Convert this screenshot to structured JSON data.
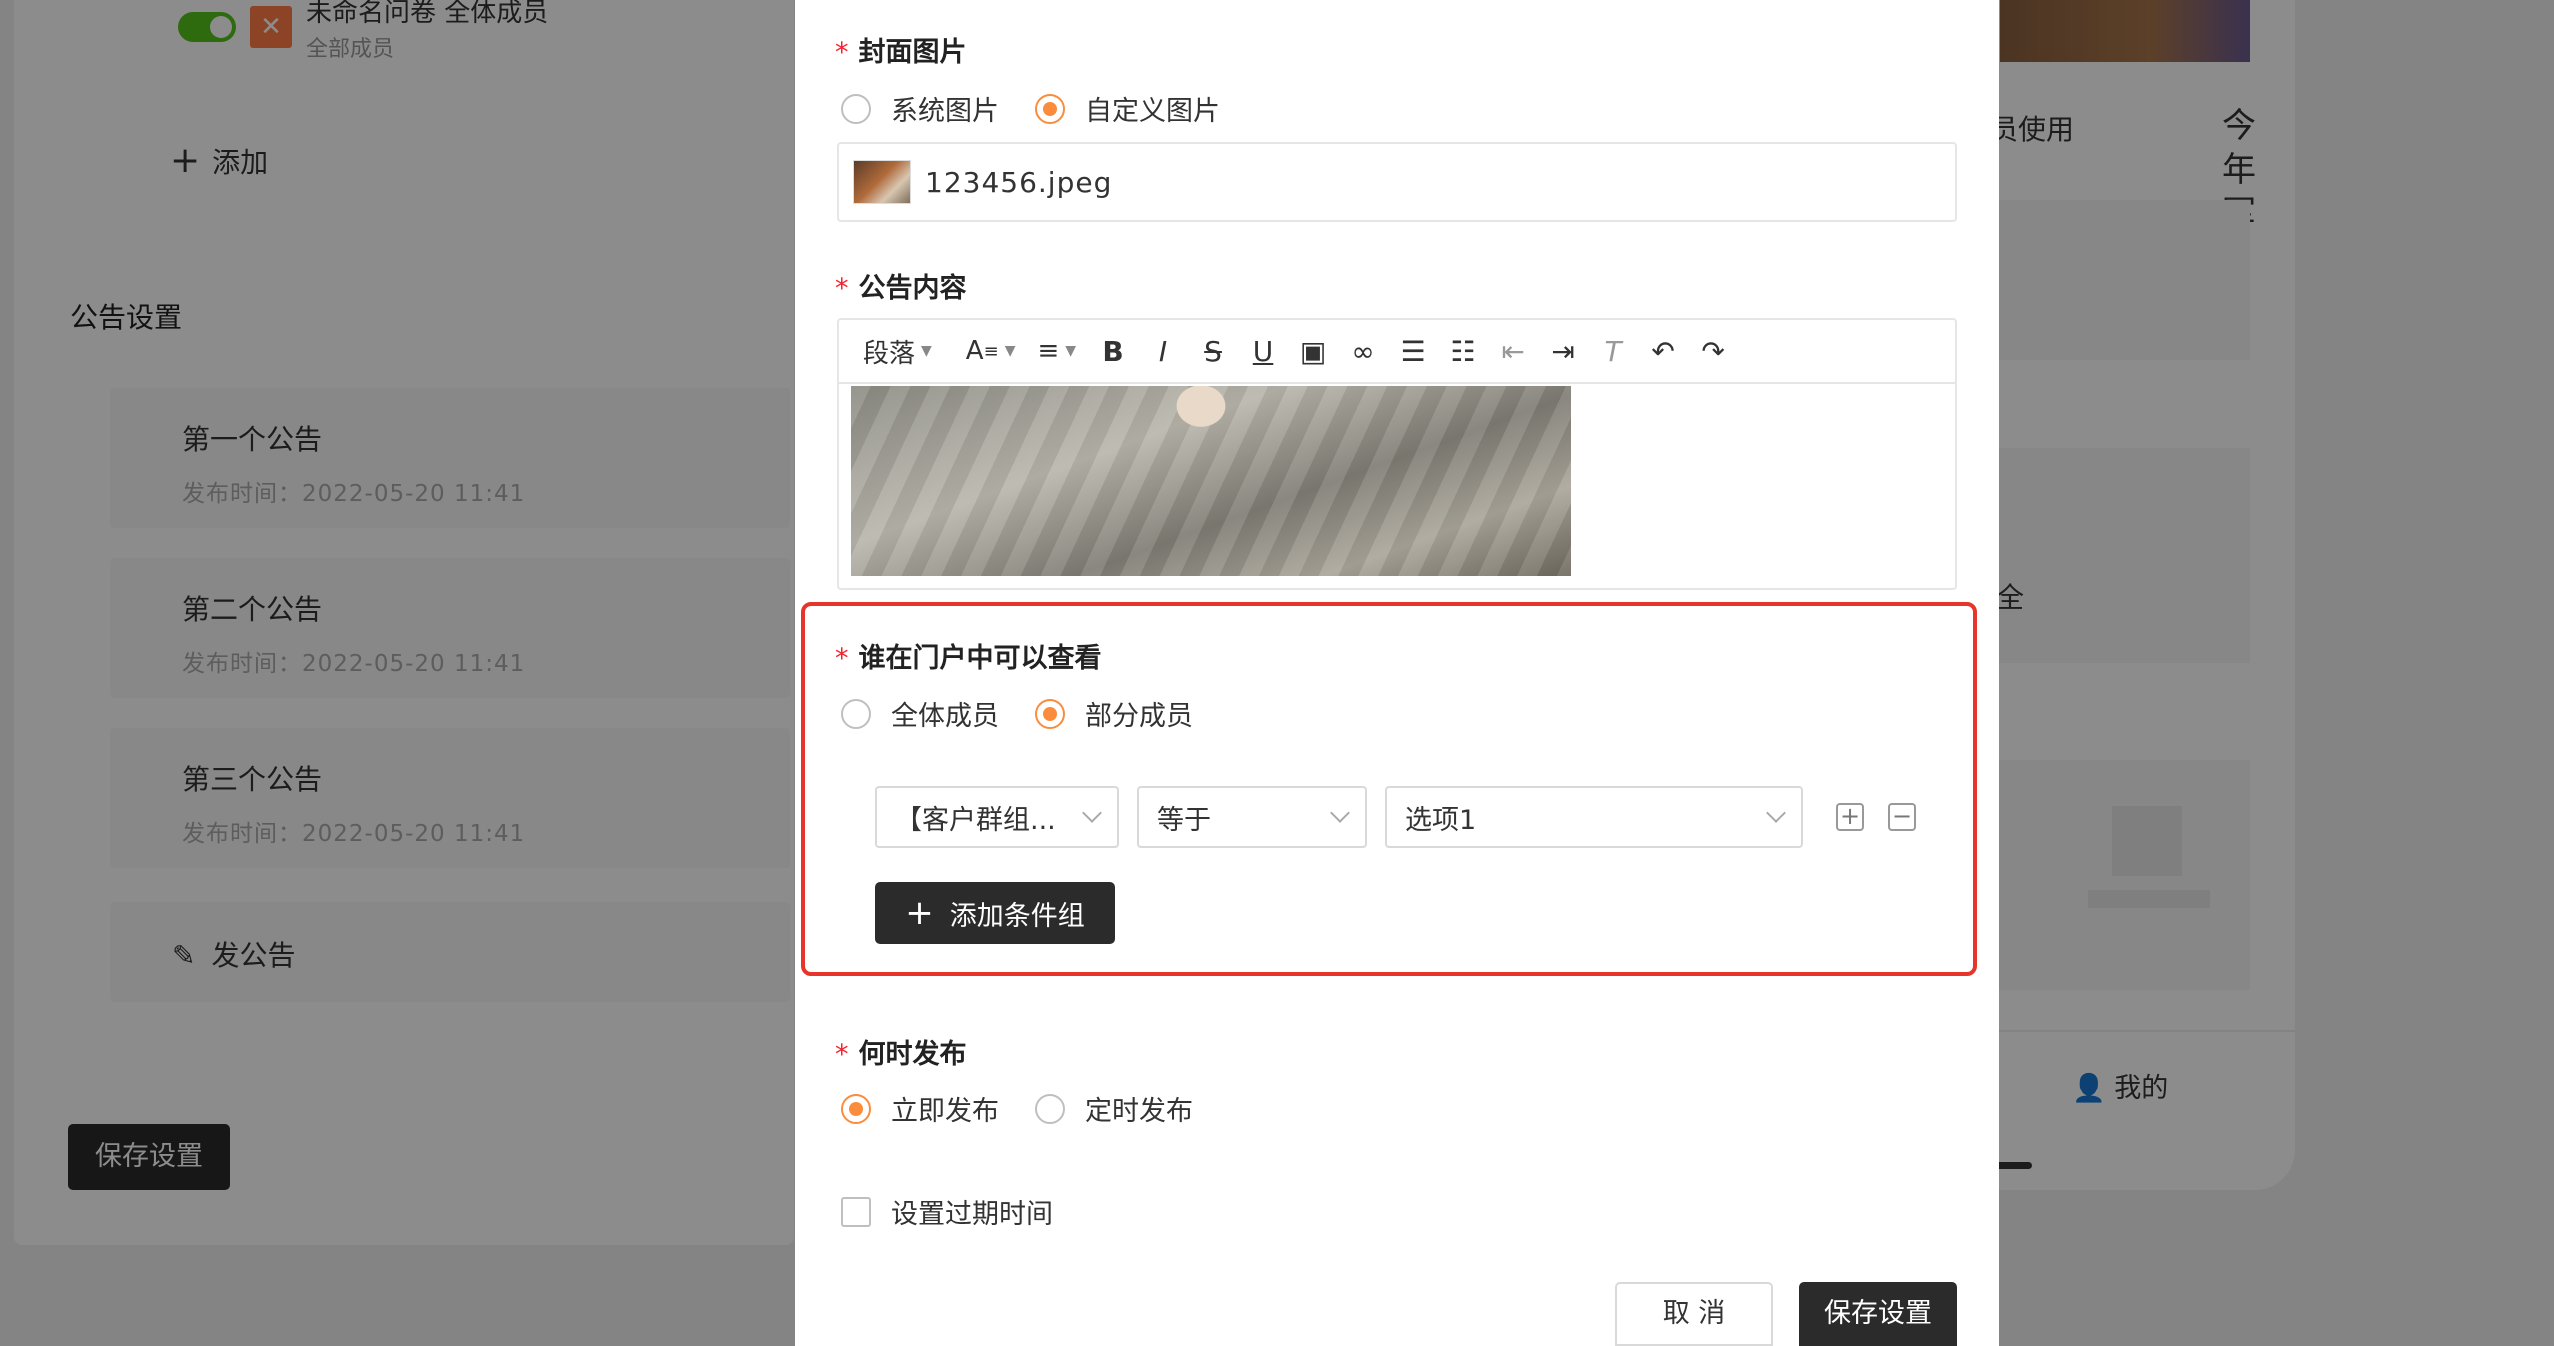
{
  "background": {
    "survey": {
      "title": "未命名问卷 全体成员",
      "subtitle": "全部成员",
      "icon": "x-icon"
    },
    "add_label": "添加",
    "section_title": "公告设置",
    "notices": [
      {
        "title": "第一个公告",
        "time": "发布时间：2022-05-20 11:41"
      },
      {
        "title": "第二个公告",
        "time": "发布时间：2022-05-20 11:41"
      },
      {
        "title": "第三个公告",
        "time": "发布时间：2022-05-20 11:41"
      }
    ],
    "publish_label": "发公告",
    "save_label": "保存设置",
    "phone": {
      "text1": "员使用",
      "vertical_text": "今年军",
      "text2": "全",
      "tab_mine": "我的"
    }
  },
  "modal": {
    "cover": {
      "label": "封面图片",
      "options": [
        "系统图片",
        "自定义图片"
      ],
      "selected": 1,
      "file_name": "123456.jpeg"
    },
    "content": {
      "label": "公告内容",
      "toolbar_paragraph": "段落",
      "toolbar_icons": [
        "font-size-icon",
        "align-icon",
        "bold-icon",
        "italic-icon",
        "strikethrough-icon",
        "underline-icon",
        "image-icon",
        "link-icon",
        "ordered-list-icon",
        "bullet-list-icon",
        "outdent-icon",
        "indent-icon",
        "clear-format-icon",
        "undo-icon",
        "redo-icon"
      ]
    },
    "visibility": {
      "label": "谁在门户中可以查看",
      "options": [
        "全体成员",
        "部分成员"
      ],
      "selected": 1,
      "condition": {
        "field": "【客户群组...",
        "operator": "等于",
        "value": "选项1"
      },
      "add_group_label": "添加条件组"
    },
    "publish_time": {
      "label": "何时发布",
      "options": [
        "立即发布",
        "定时发布"
      ],
      "selected": 0
    },
    "expire_label": "设置过期时间",
    "cancel_label": "取 消",
    "save_label": "保存设置"
  },
  "colors": {
    "accent": "#fa8c3c",
    "required": "#f5222d",
    "highlight": "#e8352b",
    "dark_button": "#2b2b2b"
  }
}
